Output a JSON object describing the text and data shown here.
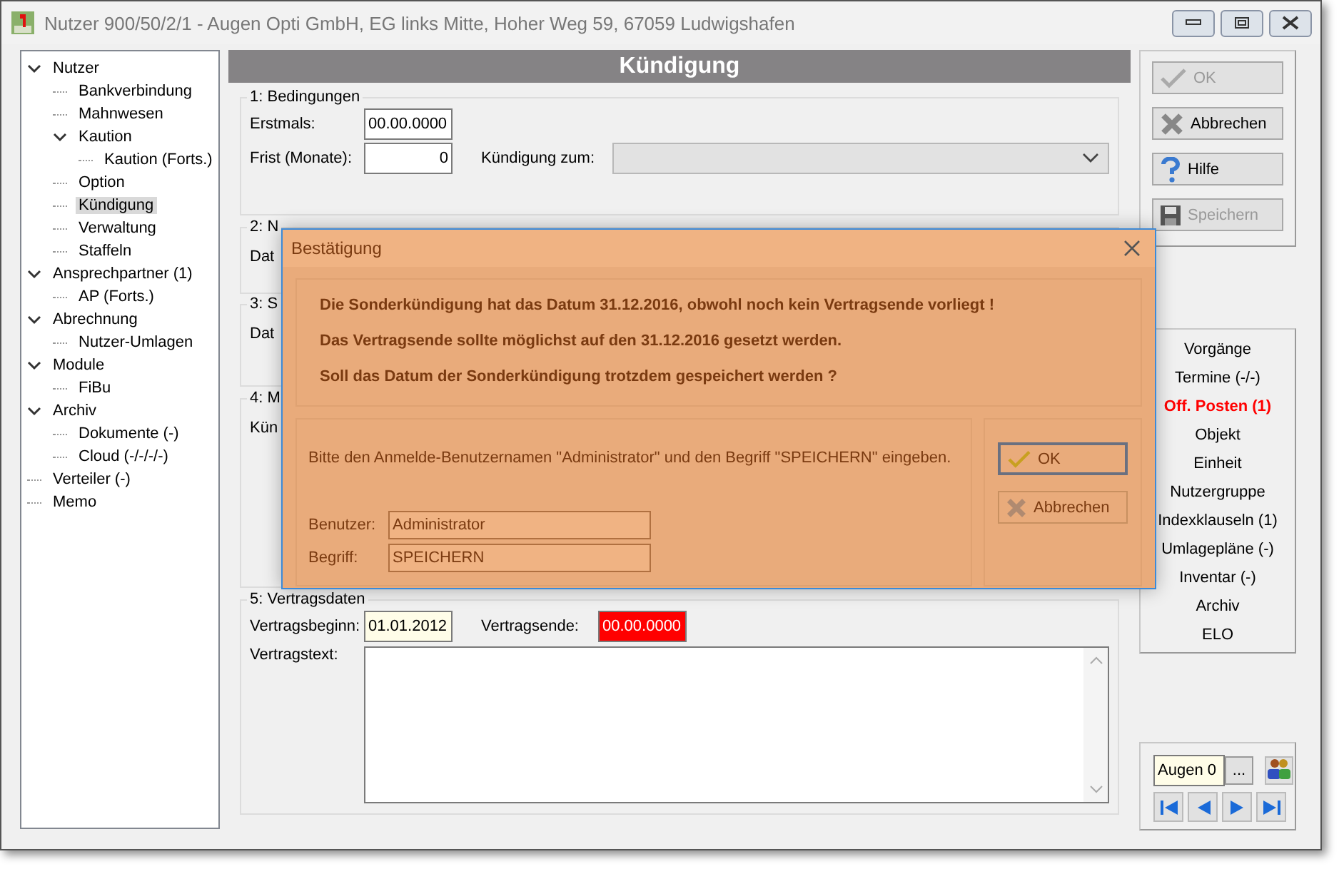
{
  "window": {
    "title": "Nutzer 900/50/2/1 - Augen Opti GmbH, EG links Mitte, Hoher Weg 59, 67059 Ludwigshafen"
  },
  "tree": [
    {
      "label": "Nutzer",
      "expanded": true,
      "selected": false,
      "children": [
        {
          "label": "Bankverbindung",
          "selected": false
        },
        {
          "label": "Mahnwesen",
          "selected": false
        },
        {
          "label": "Kaution",
          "expanded": true,
          "selected": false,
          "children": [
            {
              "label": "Kaution (Forts.)",
              "selected": false
            }
          ]
        },
        {
          "label": "Option",
          "selected": false
        },
        {
          "label": "Kündigung",
          "selected": true
        },
        {
          "label": "Verwaltung",
          "selected": false
        },
        {
          "label": "Staffeln",
          "selected": false
        }
      ]
    },
    {
      "label": "Ansprechpartner (1)",
      "expanded": true,
      "selected": false,
      "children": [
        {
          "label": "AP (Forts.)",
          "selected": false
        }
      ]
    },
    {
      "label": "Abrechnung",
      "expanded": true,
      "selected": false,
      "children": [
        {
          "label": "Nutzer-Umlagen",
          "selected": false
        }
      ]
    },
    {
      "label": "Module",
      "expanded": true,
      "selected": false,
      "children": [
        {
          "label": "FiBu",
          "selected": false
        }
      ]
    },
    {
      "label": "Archiv",
      "expanded": true,
      "selected": false,
      "children": [
        {
          "label": "Dokumente (-)",
          "selected": false
        },
        {
          "label": "Cloud (-/-/-/-)",
          "selected": false
        }
      ]
    },
    {
      "label": "Verteiler (-)",
      "selected": false
    },
    {
      "label": "Memo",
      "selected": false
    }
  ],
  "header": "Kündigung",
  "section1": {
    "legend": "1: Bedingungen",
    "erstmals_label": "Erstmals:",
    "erstmals": "00.00.0000",
    "frist_label": "Frist (Monate):",
    "frist": "0",
    "kuendigung_label": "Kündigung zum:"
  },
  "section2": {
    "legend": "2: N",
    "label": "Dat"
  },
  "section3": {
    "legend": "3: S",
    "label": "Dat"
  },
  "section4": {
    "legend": "4: M",
    "label": "Kün"
  },
  "section5": {
    "legend": "5: Vertragsdaten",
    "beginn_label": "Vertragsbeginn:",
    "beginn": "01.01.2012",
    "ende_label": "Vertragsende:",
    "ende": "00.00.0000",
    "ende_invalid": true,
    "text_label": "Vertragstext:"
  },
  "actions": [
    {
      "label": "OK",
      "kind": "ok",
      "disabled": true
    },
    {
      "label": "Abbrechen",
      "kind": "cancel",
      "disabled": false
    },
    {
      "label": "Hilfe",
      "kind": "help",
      "disabled": false
    },
    {
      "label": "Speichern",
      "kind": "save",
      "disabled": true
    }
  ],
  "links": [
    {
      "label": "Vorgänge",
      "highlighted": false
    },
    {
      "label": "Termine (-/-)",
      "highlighted": false
    },
    {
      "label": "Off. Posten (1)",
      "highlighted": true
    },
    {
      "label": "Objekt",
      "highlighted": false
    },
    {
      "label": "Einheit",
      "highlighted": false
    },
    {
      "label": "Nutzergruppe",
      "highlighted": false
    },
    {
      "label": "Indexklauseln (1)",
      "highlighted": false
    },
    {
      "label": "Umlagepläne (-)",
      "highlighted": false
    },
    {
      "label": "Inventar (-)",
      "highlighted": false
    },
    {
      "label": "Archiv",
      "highlighted": false
    },
    {
      "label": "ELO",
      "highlighted": false
    }
  ],
  "navigator": {
    "value": "Augen 0",
    "browse": "..."
  },
  "dialog": {
    "title": "Bestätigung",
    "messages": [
      "Die Sonderkündigung hat das Datum 31.12.2016, obwohl noch kein Vertragsende vorliegt !",
      "Das Vertragsende sollte möglichst auf den 31.12.2016 gesetzt werden.",
      "Soll das Datum der Sonderkündigung trotzdem gespeichert werden ?"
    ],
    "prompt": "Bitte den Anmelde-Benutzernamen \"Administrator\" und den Begriff \"SPEICHERN\" eingeben.",
    "user_label": "Benutzer:",
    "user": "Administrator",
    "term_label": "Begriff:",
    "term": "SPEICHERN",
    "buttons": [
      {
        "label": "OK",
        "kind": "ok",
        "focused": true
      },
      {
        "label": "Abbrechen",
        "kind": "cancel",
        "focused": false
      }
    ]
  }
}
